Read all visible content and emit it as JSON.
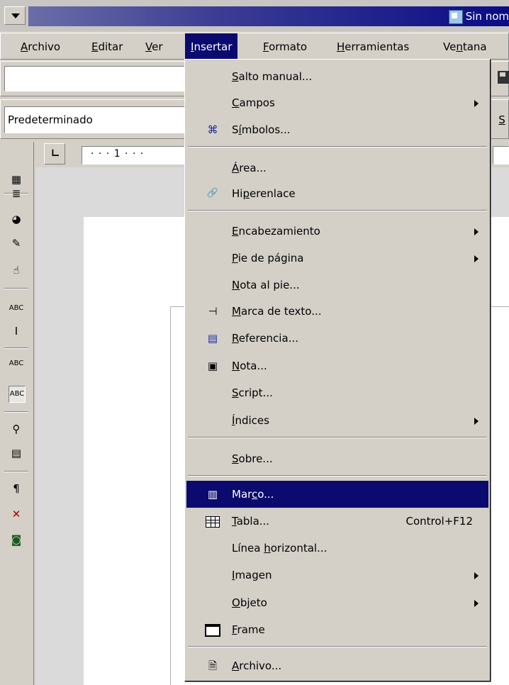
{
  "window": {
    "title": "Sin nom"
  },
  "menubar": {
    "items": [
      {
        "pre": "",
        "u": "A",
        "post": "rchivo"
      },
      {
        "pre": "",
        "u": "E",
        "post": "ditar"
      },
      {
        "pre": "",
        "u": "V",
        "post": "er"
      },
      {
        "pre": "",
        "u": "I",
        "post": "nsertar"
      },
      {
        "pre": "",
        "u": "F",
        "post": "ormato"
      },
      {
        "pre": "",
        "u": "H",
        "post": "erramientas"
      },
      {
        "pre": "Ve",
        "u": "n",
        "post": "tana"
      }
    ]
  },
  "toolbar": {
    "url_value": "",
    "paragraph_style": "Predeterminado",
    "right_fragment": "S"
  },
  "ruler": {
    "text": "· · · 1 · · ·"
  },
  "insert_menu": {
    "items": [
      {
        "pre": "",
        "u": "S",
        "post": "alto manual...",
        "icon": "",
        "submenu": false,
        "shortcut": ""
      },
      {
        "pre": "",
        "u": "C",
        "post": "ampos",
        "icon": "",
        "submenu": true,
        "shortcut": ""
      },
      {
        "pre": "S",
        "u": "í",
        "post": "mbolos...",
        "icon": "⌘",
        "submenu": false,
        "shortcut": ""
      },
      {
        "pre": "",
        "u": "Á",
        "post": "rea...",
        "icon": "",
        "submenu": false,
        "shortcut": ""
      },
      {
        "pre": "Hi",
        "u": "p",
        "post": "erenlace",
        "icon": "🔗",
        "submenu": false,
        "shortcut": ""
      },
      {
        "pre": "",
        "u": "E",
        "post": "ncabezamiento",
        "icon": "",
        "submenu": true,
        "shortcut": ""
      },
      {
        "pre": "",
        "u": "P",
        "post": "ie de página",
        "icon": "",
        "submenu": true,
        "shortcut": ""
      },
      {
        "pre": "",
        "u": "N",
        "post": "ota al pie...",
        "icon": "",
        "submenu": false,
        "shortcut": ""
      },
      {
        "pre": "",
        "u": "M",
        "post": "arca de texto...",
        "icon": "⊣",
        "submenu": false,
        "shortcut": ""
      },
      {
        "pre": "",
        "u": "R",
        "post": "eferencia...",
        "icon": "▤",
        "submenu": false,
        "shortcut": ""
      },
      {
        "pre": "",
        "u": "N",
        "post": "ota...",
        "icon": "▣",
        "submenu": false,
        "shortcut": ""
      },
      {
        "pre": "",
        "u": "S",
        "post": "cript...",
        "icon": "",
        "submenu": false,
        "shortcut": ""
      },
      {
        "pre": "",
        "u": "Í",
        "post": "ndices",
        "icon": "",
        "submenu": true,
        "shortcut": ""
      },
      {
        "pre": "",
        "u": "S",
        "post": "obre...",
        "icon": "",
        "submenu": false,
        "shortcut": ""
      },
      {
        "pre": "Mar",
        "u": "c",
        "post": "o...",
        "icon": "▥",
        "submenu": false,
        "shortcut": ""
      },
      {
        "pre": "",
        "u": "T",
        "post": "abla...",
        "icon": "",
        "submenu": false,
        "shortcut": "Control+F12"
      },
      {
        "pre": "Línea ",
        "u": "h",
        "post": "orizontal...",
        "icon": "",
        "submenu": false,
        "shortcut": ""
      },
      {
        "pre": "",
        "u": "I",
        "post": "magen",
        "icon": "",
        "submenu": true,
        "shortcut": ""
      },
      {
        "pre": "",
        "u": "O",
        "post": "bjeto",
        "icon": "",
        "submenu": true,
        "shortcut": ""
      },
      {
        "pre": "",
        "u": "F",
        "post": "rame",
        "icon": "",
        "submenu": false,
        "shortcut": ""
      },
      {
        "pre": "",
        "u": "A",
        "post": "rchivo...",
        "icon": "🗎",
        "submenu": false,
        "shortcut": ""
      }
    ]
  },
  "left_toolbar_icons": [
    "insert-object-icon",
    "insert-fields-icon",
    "insert-chart-icon",
    "edit-file-icon",
    "insert-controls-icon",
    "autospellcheck-text-icon",
    "text-cursor-icon",
    "spellcheck-icon",
    "autospellcheck-icon",
    "find-icon",
    "data-sources-icon",
    "formatting-marks-icon",
    "delete-icon",
    "web-view-icon"
  ]
}
